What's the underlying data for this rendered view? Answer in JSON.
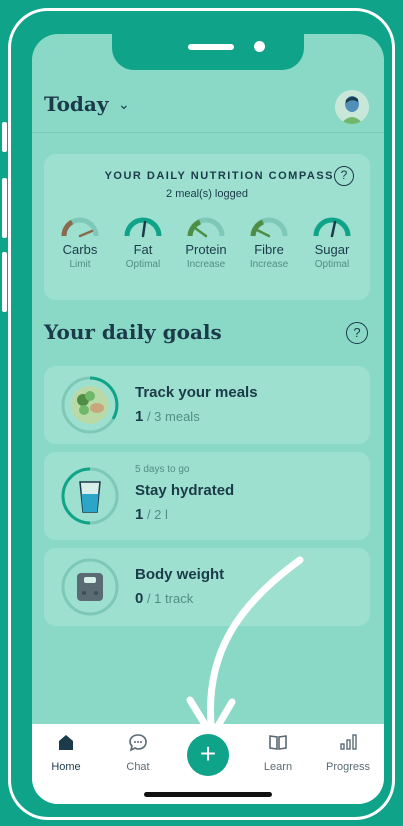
{
  "header": {
    "title": "Today"
  },
  "compass": {
    "title": "YOUR DAILY NUTRITION COMPASS",
    "subtitle": "2 meal(s) logged",
    "help": "?",
    "gauges": [
      {
        "name": "Carbs",
        "status": "Limit",
        "color": "#8a6a4a"
      },
      {
        "name": "Fat",
        "status": "Optimal",
        "color": "#0fa389"
      },
      {
        "name": "Protein",
        "status": "Increase",
        "color": "#4e8d44"
      },
      {
        "name": "Fibre",
        "status": "Increase",
        "color": "#4e8d44"
      },
      {
        "name": "Sugar",
        "status": "Optimal",
        "color": "#0fa389"
      }
    ]
  },
  "goals": {
    "title": "Your daily goals",
    "help": "?",
    "items": [
      {
        "pre": "",
        "title": "Track your meals",
        "current": "1",
        "target": " / 3 meals"
      },
      {
        "pre": "5 days to go",
        "title": "Stay hydrated",
        "current": "1",
        "target": " / 2 l"
      },
      {
        "pre": "",
        "title": "Body weight",
        "current": "0",
        "target": " / 1 track"
      }
    ]
  },
  "tabbar": {
    "home": "Home",
    "chat": "Chat",
    "add": "+",
    "learn": "Learn",
    "progress": "Progress"
  },
  "colors": {
    "accent": "#0fa389",
    "text": "#1b3a4a",
    "muted": "#4f8f82"
  }
}
